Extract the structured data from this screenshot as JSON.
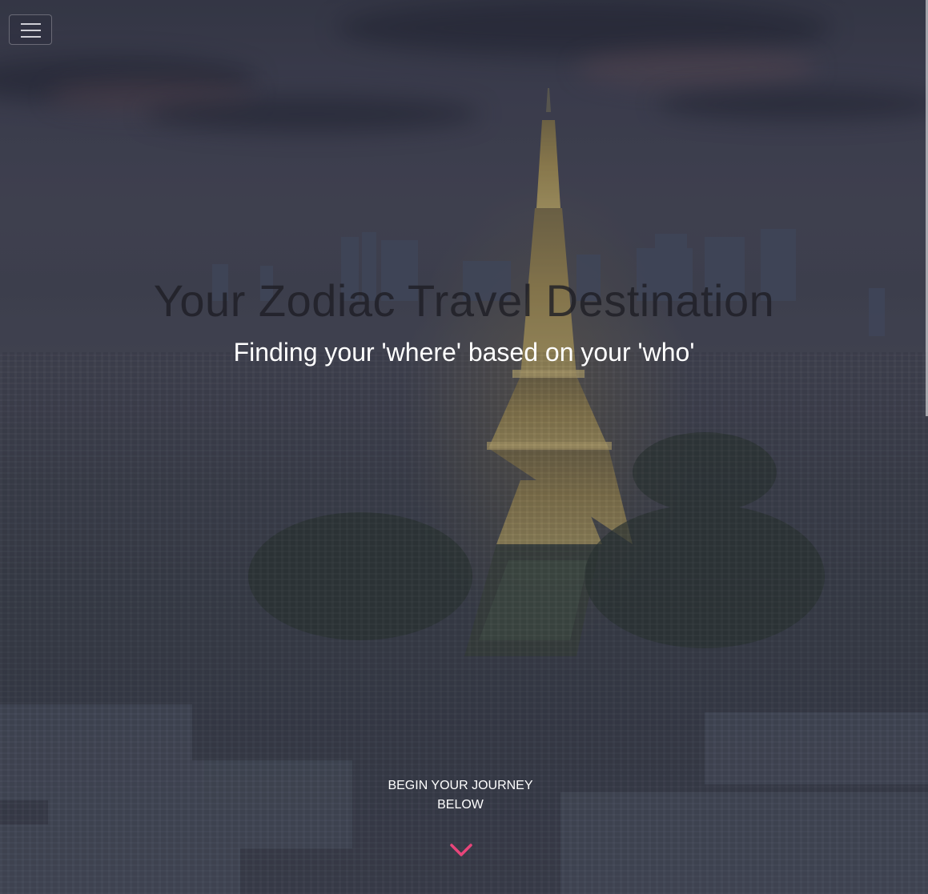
{
  "header": {
    "menu_icon": "hamburger-menu-icon"
  },
  "hero": {
    "title": "Your Zodiac Travel Destination",
    "subtitle": "Finding your 'where' based on your 'who'",
    "cta_line1": "BEGIN YOUR JOURNEY",
    "cta_line2": "BELOW",
    "cta_icon": "chevron-down-icon"
  },
  "colors": {
    "accent": "#e8457a",
    "title_text": "#1e1e26",
    "subtitle_text": "#ffffff"
  }
}
